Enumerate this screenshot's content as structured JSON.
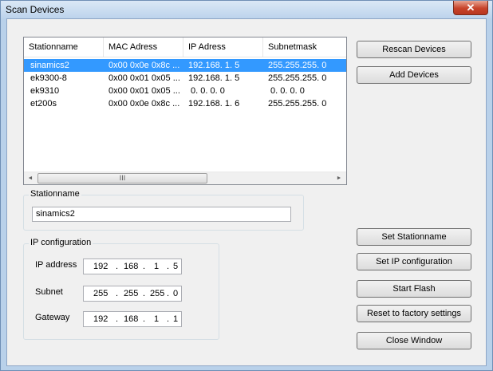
{
  "window": {
    "title": "Scan Devices",
    "close_glyph": "✕"
  },
  "listview": {
    "columns": [
      "Stationname",
      "MAC Adress",
      "IP Adress",
      "Subnetmask"
    ],
    "rows": [
      [
        "sinamics2",
        "0x00 0x0e 0x8c ...",
        "192.168. 1. 5",
        "255.255.255. 0"
      ],
      [
        "ek9300-8",
        "0x00 0x01 0x05 ...",
        "192.168. 1. 5",
        "255.255.255. 0"
      ],
      [
        "ek9310",
        "0x00 0x01 0x05 ...",
        " 0. 0. 0. 0",
        " 0. 0. 0. 0"
      ],
      [
        "et200s",
        "0x00 0x0e 0x8c ...",
        "192.168. 1. 6",
        "255.255.255. 0"
      ]
    ],
    "selected_row": 0,
    "scroll_left": "◄",
    "scroll_right": "►",
    "thumb_grip": "III"
  },
  "buttons": {
    "rescan": "Rescan Devices",
    "add": "Add Devices",
    "set_stationname": "Set Stationname",
    "set_ip": "Set IP configuration",
    "start_flash": "Start Flash",
    "reset": "Reset to factory settings",
    "close": "Close Window"
  },
  "stationname_group": {
    "label": "Stationname",
    "value": "sinamics2"
  },
  "ip_group": {
    "label": "IP configuration",
    "ip_label": "IP address",
    "ip": [
      "192",
      "168",
      "1",
      "5"
    ],
    "subnet_label": "Subnet",
    "subnet": [
      "255",
      "255",
      "255",
      "0"
    ],
    "gateway_label": "Gateway",
    "gateway": [
      "192",
      "168",
      "1",
      "1"
    ]
  }
}
